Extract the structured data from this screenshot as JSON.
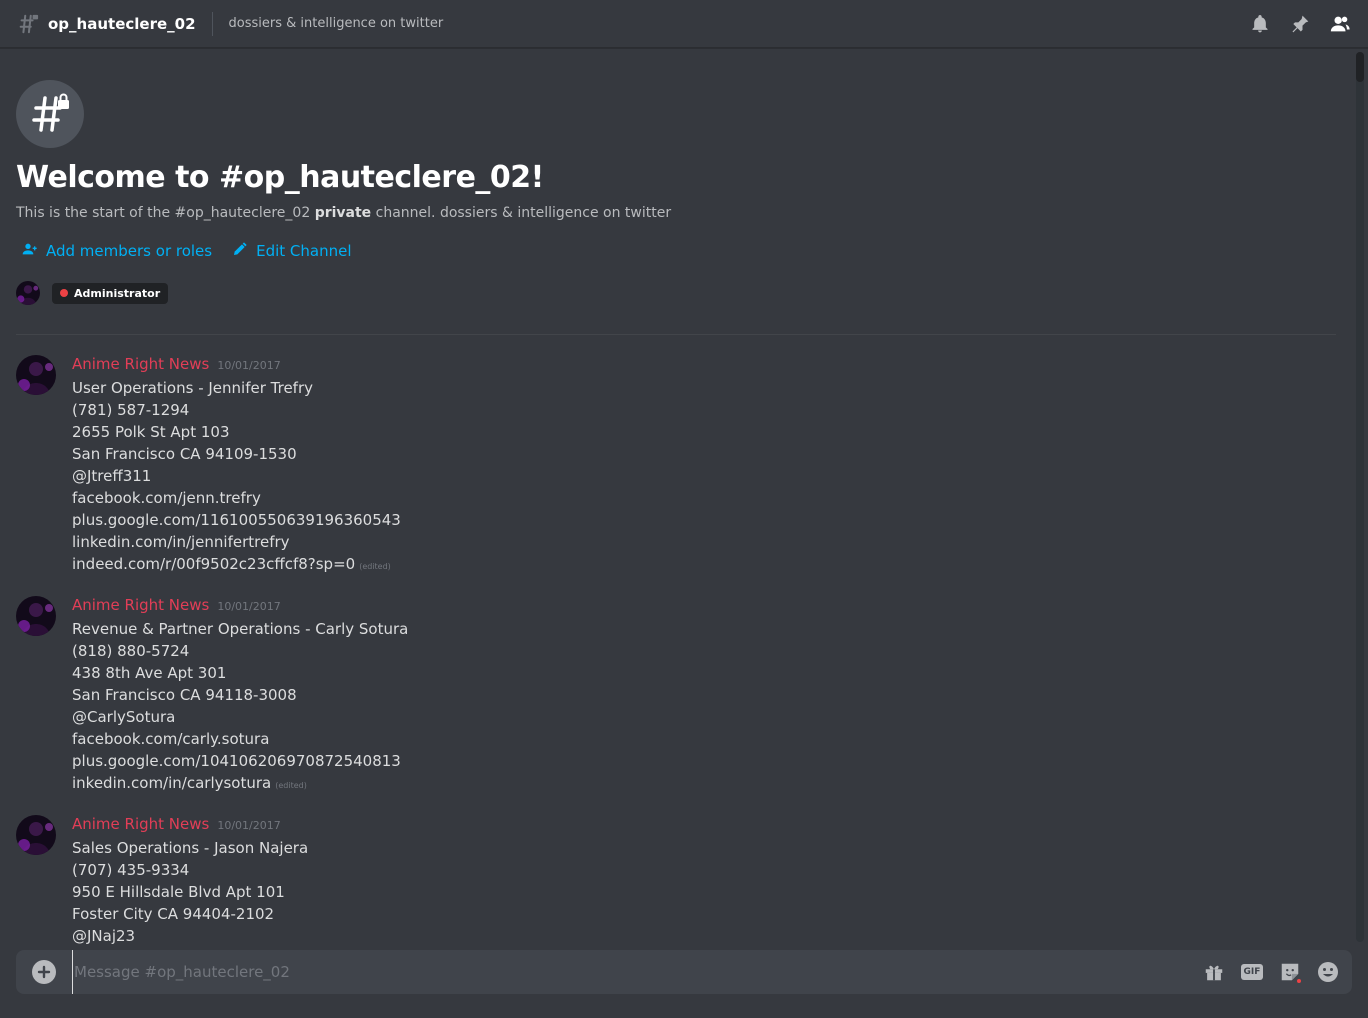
{
  "header": {
    "channel_name": "op_hauteclere_02",
    "topic": "dossiers & intelligence on twitter"
  },
  "welcome": {
    "title": "Welcome to #op_hauteclere_02!",
    "desc_prefix": "This is the start of the #op_hauteclere_02",
    "desc_bold": "private",
    "desc_suffix": "channel. dossiers & intelligence on twitter",
    "add_members_label": "Add members or roles",
    "edit_channel_label": "Edit Channel",
    "role_name": "Administrator",
    "role_color": "#ed4245"
  },
  "colors": {
    "accent_link": "#00b0f4",
    "author_color": "#e23e57",
    "background": "#36393f"
  },
  "messages": [
    {
      "author": "Anime Right News",
      "timestamp": "10/01/2017",
      "lines": [
        "User Operations - Jennifer Trefry",
        "(781) 587-1294",
        "2655 Polk St Apt 103",
        "San Francisco CA 94109-1530",
        "@Jtreff311",
        "facebook.com/jenn.trefry",
        "plus.google.com/116100550639196360543",
        "linkedin.com/in/jennifertrefry",
        "indeed.com/r/00f9502c23cffcf8?sp=0"
      ],
      "edited": "(edited)"
    },
    {
      "author": "Anime Right News",
      "timestamp": "10/01/2017",
      "lines": [
        "Revenue & Partner Operations - Carly Sotura",
        "(818) 880-5724",
        "438 8th Ave Apt 301",
        "San Francisco CA 94118-3008",
        "@CarlySotura",
        "facebook.com/carly.sotura",
        "plus.google.com/104106206970872540813",
        "inkedin.com/in/carlysotura"
      ],
      "edited": "(edited)"
    },
    {
      "author": "Anime Right News",
      "timestamp": "10/01/2017",
      "lines": [
        "Sales Operations - Jason Najera",
        "(707) 435-9334",
        "950 E Hillsdale Blvd Apt 101",
        "Foster City CA 94404-2102",
        "@JNaj23"
      ]
    }
  ],
  "composer": {
    "placeholder": "Message #op_hauteclere_02",
    "gif_label": "GIF"
  },
  "icons": {
    "header": [
      "hash-icon",
      "bell-icon",
      "pin-icon",
      "members-icon"
    ],
    "composer": [
      "plus-icon",
      "gift-icon",
      "gif-icon",
      "sticker-icon",
      "emoji-icon"
    ]
  }
}
